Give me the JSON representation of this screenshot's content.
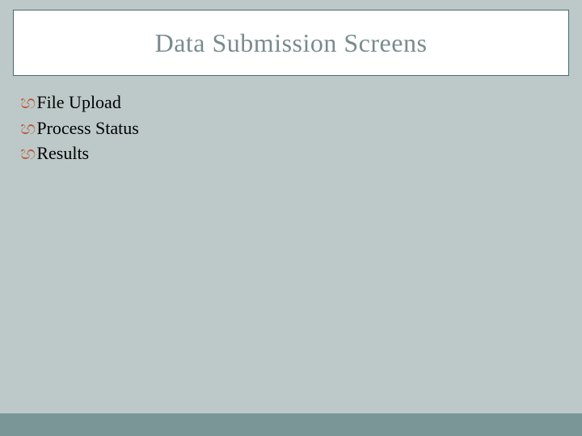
{
  "title": "Data Submission Screens",
  "bullets": [
    {
      "icon": "ℓ",
      "text": "File Upload"
    },
    {
      "icon": "ℓ",
      "text": "Process Status"
    },
    {
      "icon": "ℓ",
      "text": "Results"
    }
  ]
}
